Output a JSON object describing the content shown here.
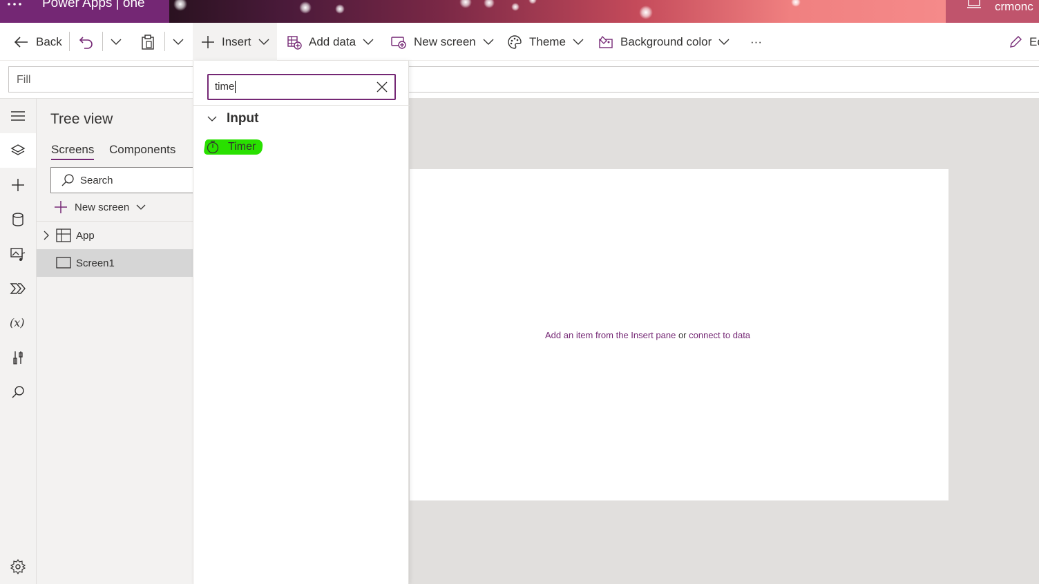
{
  "titlebar": {
    "app_title": "Power Apps  |  one",
    "user_name": "crmonc"
  },
  "commandbar": {
    "back": "Back",
    "insert": "Insert",
    "add_data": "Add data",
    "new_screen": "New screen",
    "theme": "Theme",
    "background_color": "Background color",
    "more": "···",
    "edit_truncated": "Ec"
  },
  "formulabar": {
    "property": "Fill"
  },
  "treeview": {
    "title": "Tree view",
    "tabs": [
      "Screens",
      "Components"
    ],
    "search_placeholder": "Search",
    "new_screen": "New screen",
    "rows": [
      {
        "label": "App"
      },
      {
        "label": "Screen1"
      }
    ]
  },
  "insert_pane": {
    "search_value": "time",
    "group": "Input",
    "item": "Timer"
  },
  "canvas": {
    "hint_part1": "Add an item from the Insert pane",
    "hint_or": "or",
    "hint_link": "connect to data"
  },
  "colors": {
    "brand": "#742774",
    "highlight": "#29e000"
  }
}
